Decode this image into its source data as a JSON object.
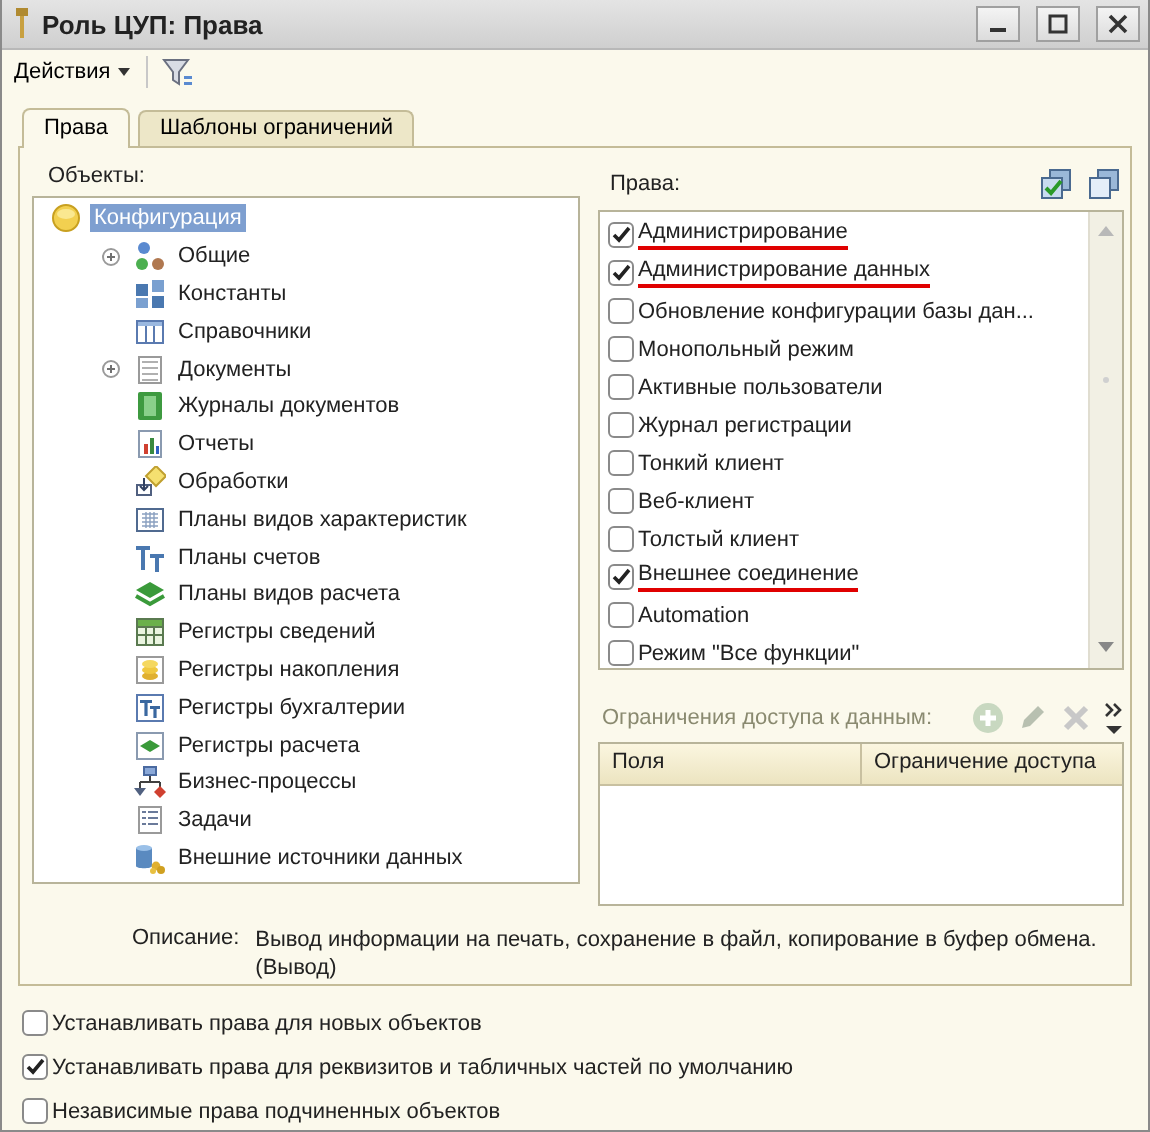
{
  "window": {
    "title": "Роль ЦУП: Права"
  },
  "toolbar": {
    "actions_menu": "Действия"
  },
  "tabs": [
    {
      "label": "Права",
      "selected": true
    },
    {
      "label": "Шаблоны ограничений",
      "selected": false
    }
  ],
  "objects": {
    "label": "Объекты:",
    "tree": [
      {
        "label": "Конфигурация",
        "selected": true,
        "children": [
          {
            "label": "Общие",
            "selected": false,
            "expandable": true
          },
          {
            "label": "Константы",
            "selected": false,
            "expandable": false
          },
          {
            "label": "Справочники",
            "selected": false,
            "expandable": false
          },
          {
            "label": "Документы",
            "selected": false,
            "expandable": true
          },
          {
            "label": "Журналы документов",
            "selected": false,
            "expandable": false
          },
          {
            "label": "Отчеты",
            "selected": false,
            "expandable": false
          },
          {
            "label": "Обработки",
            "selected": false,
            "expandable": false
          },
          {
            "label": "Планы видов характеристик",
            "selected": false,
            "expandable": false
          },
          {
            "label": "Планы счетов",
            "selected": false,
            "expandable": false
          },
          {
            "label": "Планы видов расчета",
            "selected": false,
            "expandable": false
          },
          {
            "label": "Регистры сведений",
            "selected": false,
            "expandable": false
          },
          {
            "label": "Регистры накопления",
            "selected": false,
            "expandable": false
          },
          {
            "label": "Регистры бухгалтерии",
            "selected": false,
            "expandable": false
          },
          {
            "label": "Регистры расчета",
            "selected": false,
            "expandable": false
          },
          {
            "label": "Бизнес-процессы",
            "selected": false,
            "expandable": false
          },
          {
            "label": "Задачи",
            "selected": false,
            "expandable": false
          },
          {
            "label": "Внешние источники данных",
            "selected": false,
            "expandable": false
          }
        ]
      }
    ]
  },
  "rights": {
    "label": "Права:",
    "items": [
      {
        "label": "Администрирование",
        "checked": true,
        "underlined": true
      },
      {
        "label": "Администрирование данных",
        "checked": true,
        "underlined": true
      },
      {
        "label": "Обновление конфигурации базы дан...",
        "checked": false,
        "underlined": false
      },
      {
        "label": "Монопольный режим",
        "checked": false,
        "underlined": false
      },
      {
        "label": "Активные пользователи",
        "checked": false,
        "underlined": false
      },
      {
        "label": "Журнал регистрации",
        "checked": false,
        "underlined": false
      },
      {
        "label": "Тонкий клиент",
        "checked": false,
        "underlined": false
      },
      {
        "label": "Веб-клиент",
        "checked": false,
        "underlined": false
      },
      {
        "label": "Толстый клиент",
        "checked": false,
        "underlined": false
      },
      {
        "label": "Внешнее соединение",
        "checked": true,
        "underlined": true
      },
      {
        "label": "Automation",
        "checked": false,
        "underlined": false
      },
      {
        "label": "Режим \"Все функции\"",
        "checked": false,
        "underlined": false
      }
    ]
  },
  "restrictions": {
    "label": "Ограничения доступа к данным:",
    "columns": [
      "Поля",
      "Ограничение доступа"
    ]
  },
  "description": {
    "label": "Описание:",
    "text": "Вывод информации на печать, сохранение в файл, копирование в буфер обмена.\n(Вывод)"
  },
  "options": [
    {
      "label": "Устанавливать права для новых объектов",
      "checked": false
    },
    {
      "label": "Устанавливать права для реквизитов и табличных частей по умолчанию",
      "checked": true
    },
    {
      "label": "Независимые права подчиненных объектов",
      "checked": false
    }
  ]
}
